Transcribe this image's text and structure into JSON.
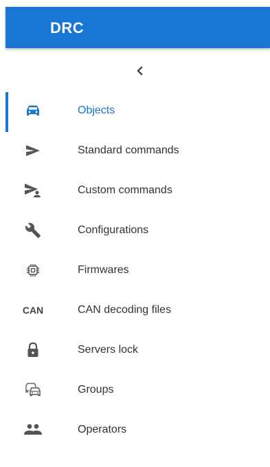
{
  "app": {
    "title": "DRC",
    "accent": "#1976d2"
  },
  "collapse": {
    "icon": "chevron-left-icon"
  },
  "nav": {
    "items": [
      {
        "label": "Objects",
        "icon": "car-icon",
        "active": true
      },
      {
        "label": "Standard commands",
        "icon": "send-icon",
        "active": false
      },
      {
        "label": "Custom commands",
        "icon": "send-person-icon",
        "active": false
      },
      {
        "label": "Configurations",
        "icon": "wrench-icon",
        "active": false
      },
      {
        "label": "Firmwares",
        "icon": "chip-icon",
        "active": false
      },
      {
        "label": "CAN decoding files",
        "icon": "can-icon",
        "icon_text": "CAN",
        "active": false
      },
      {
        "label": "Servers lock",
        "icon": "lock-icon",
        "active": false
      },
      {
        "label": "Groups",
        "icon": "vehicle-group-icon",
        "active": false
      },
      {
        "label": "Operators",
        "icon": "people-icon",
        "active": false
      }
    ]
  }
}
